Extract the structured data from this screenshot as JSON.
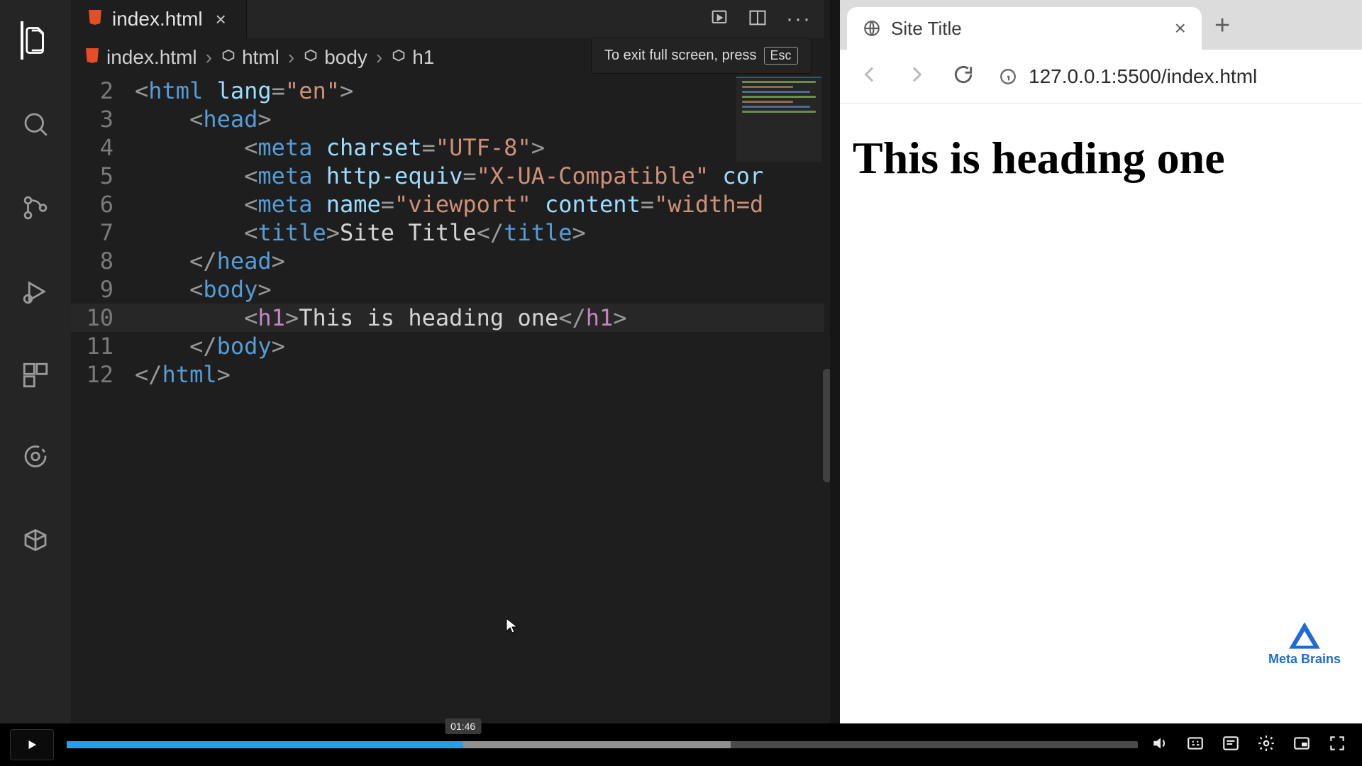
{
  "vscode": {
    "tab": {
      "filename": "index.html"
    },
    "breadcrumb": {
      "file": "index.html",
      "p1": "html",
      "p2": "body",
      "p3": "h1"
    },
    "lines": {
      "n2": "2",
      "n3": "3",
      "n4": "4",
      "n5": "5",
      "n6": "6",
      "n7": "7",
      "n8": "8",
      "n9": "9",
      "n10": "10",
      "n11": "11",
      "n12": "12"
    },
    "code": {
      "l2": {
        "open": "<",
        "tag": "html",
        "attr": " lang",
        "eq": "=",
        "str": "\"en\"",
        "close": ">"
      },
      "l3": {
        "open": "<",
        "tag": "head",
        "close": ">"
      },
      "l4": {
        "open": "<",
        "tag": "meta",
        "attr": " charset",
        "eq": "=",
        "str": "\"UTF-8\"",
        "close": ">"
      },
      "l5": {
        "open": "<",
        "tag": "meta",
        "attr": " http-equiv",
        "eq": "=",
        "str": "\"X-UA-Compatible\"",
        "rest": " cor"
      },
      "l6": {
        "open": "<",
        "tag": "meta",
        "attr": " name",
        "eq": "=",
        "str": "\"viewport\"",
        "attr2": " content",
        "eq2": "=",
        "str2": "\"width=d"
      },
      "l7": {
        "open": "<",
        "tag": "title",
        "close1": ">",
        "text": "Site Title",
        "open2": "</",
        "close": ">"
      },
      "l8": {
        "open": "</",
        "tag": "head",
        "close": ">"
      },
      "l9": {
        "open": "<",
        "tag": "body",
        "close": ">"
      },
      "l10": {
        "open": "<",
        "tag": "h1",
        "close1": ">",
        "text": "This is heading one",
        "open2": "</",
        "close": ">"
      },
      "l11": {
        "open": "</",
        "tag": "body",
        "close": ">"
      },
      "l12": {
        "open": "</",
        "tag": "html",
        "close": ">"
      }
    },
    "fullscreen_hint": {
      "text": "To exit full screen, press",
      "key": "Esc"
    }
  },
  "browser": {
    "tab_title": "Site Title",
    "url": "127.0.0.1:5500/index.html",
    "page_h1": "This is heading one",
    "watermark": "Meta Brains"
  },
  "player": {
    "progress_pct": 37,
    "time_label": "01:46"
  }
}
